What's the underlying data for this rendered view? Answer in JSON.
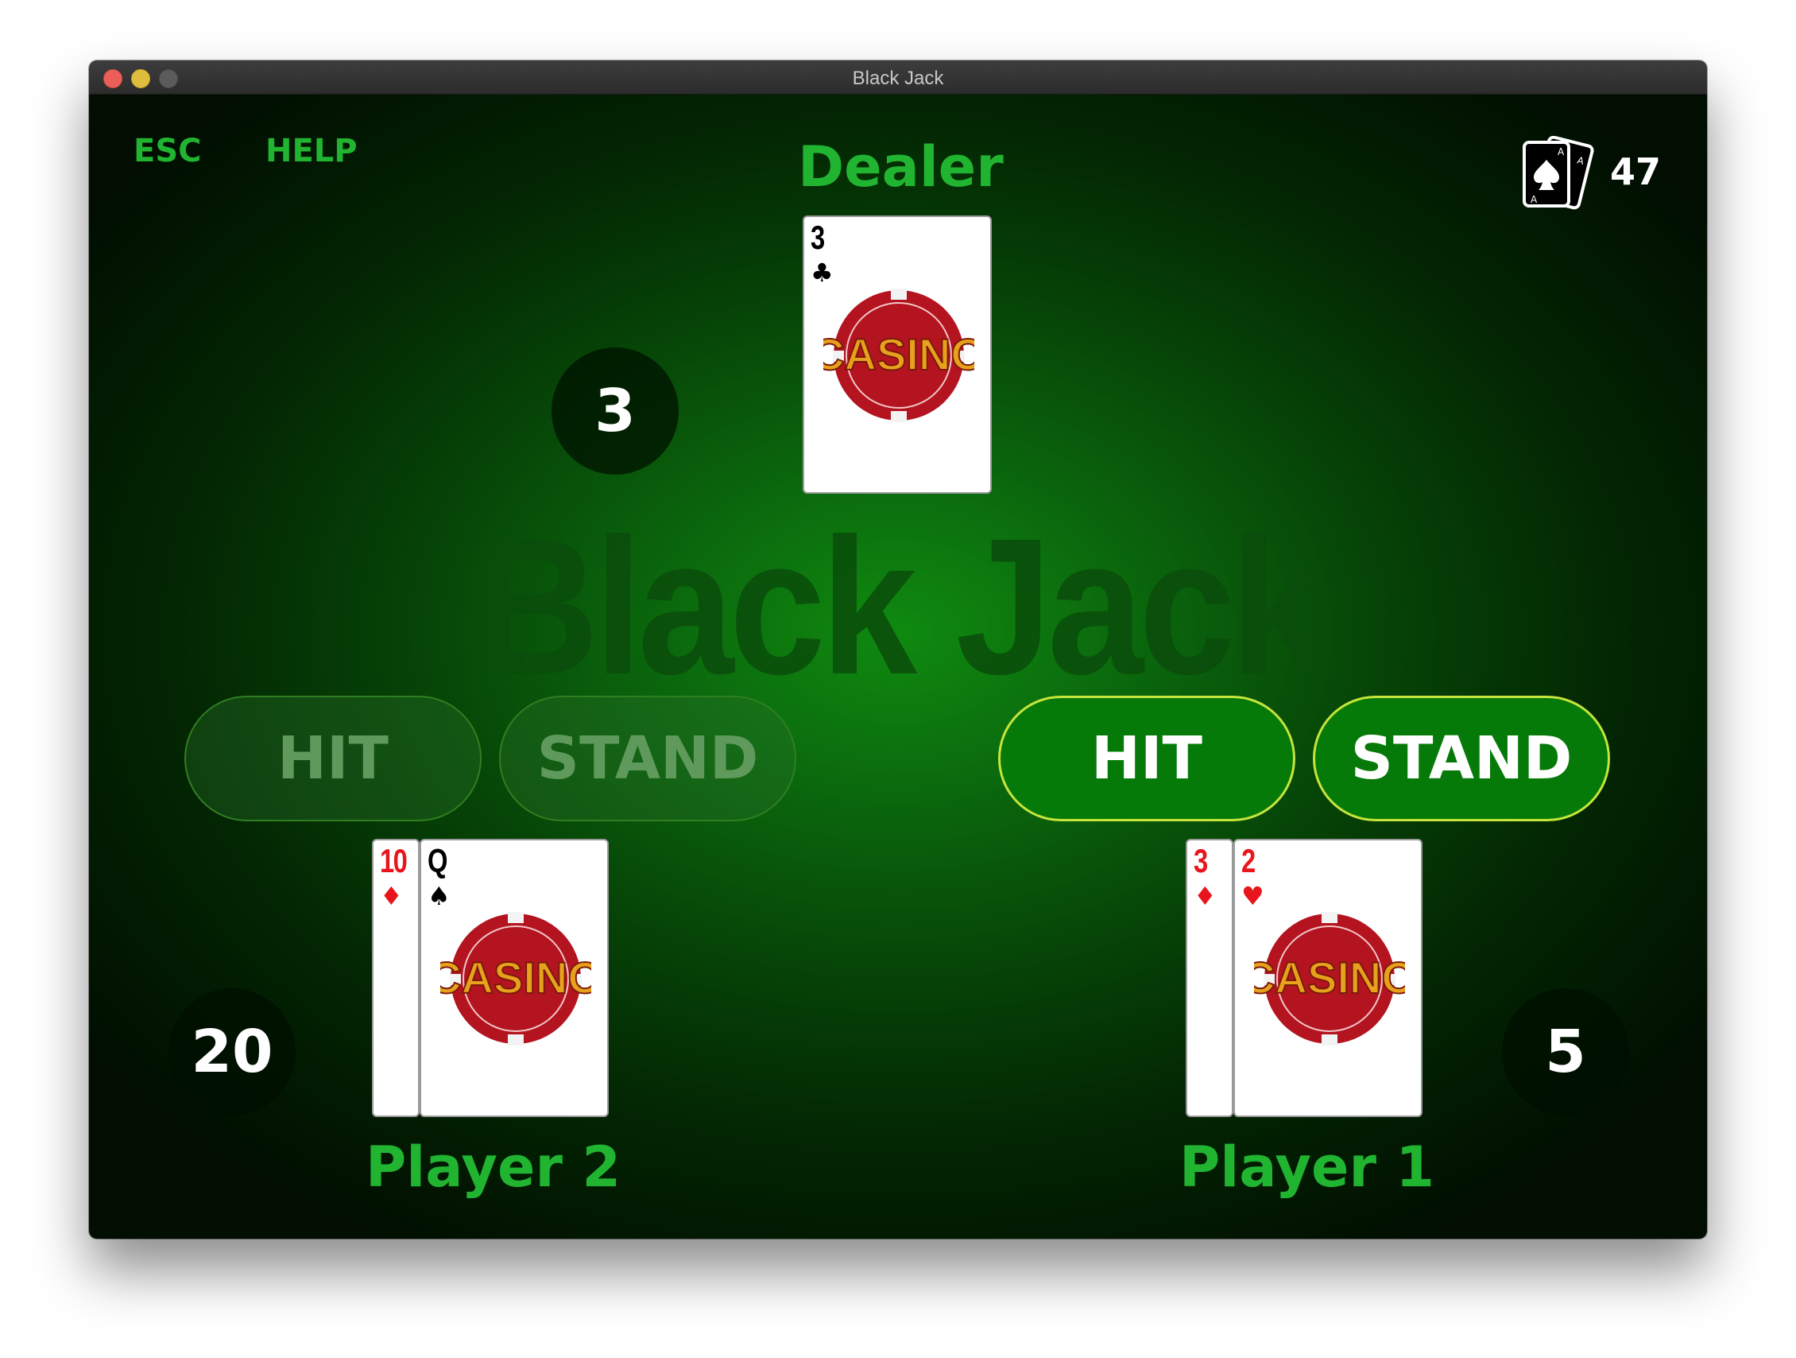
{
  "window": {
    "title": "Black Jack"
  },
  "menu": {
    "esc": "ESC",
    "help": "HELP"
  },
  "deck": {
    "icon": "deck-of-cards-icon",
    "count": "47"
  },
  "watermark": "Black Jack",
  "dealer": {
    "label": "Dealer",
    "score": "3",
    "cards": [
      {
        "rank": "3",
        "suit": "♣",
        "color": "black"
      }
    ]
  },
  "players": [
    {
      "label": "Player 2",
      "score": "20",
      "hit_label": "HIT",
      "stand_label": "STAND",
      "active": false,
      "cards": [
        {
          "rank": "10",
          "suit": "♦",
          "color": "red"
        },
        {
          "rank": "Q",
          "suit": "♠",
          "color": "black"
        }
      ]
    },
    {
      "label": "Player 1",
      "score": "5",
      "hit_label": "HIT",
      "stand_label": "STAND",
      "active": true,
      "cards": [
        {
          "rank": "3",
          "suit": "♦",
          "color": "red"
        },
        {
          "rank": "2",
          "suit": "♥",
          "color": "red"
        }
      ]
    }
  ],
  "card_art": {
    "text": "CASINO",
    "chip_color": "#b3141f",
    "letter_color": "#e8a11c"
  },
  "colors": {
    "label_green": "#21b431",
    "active_button": "#067a09",
    "active_border": "#c5e53b"
  }
}
